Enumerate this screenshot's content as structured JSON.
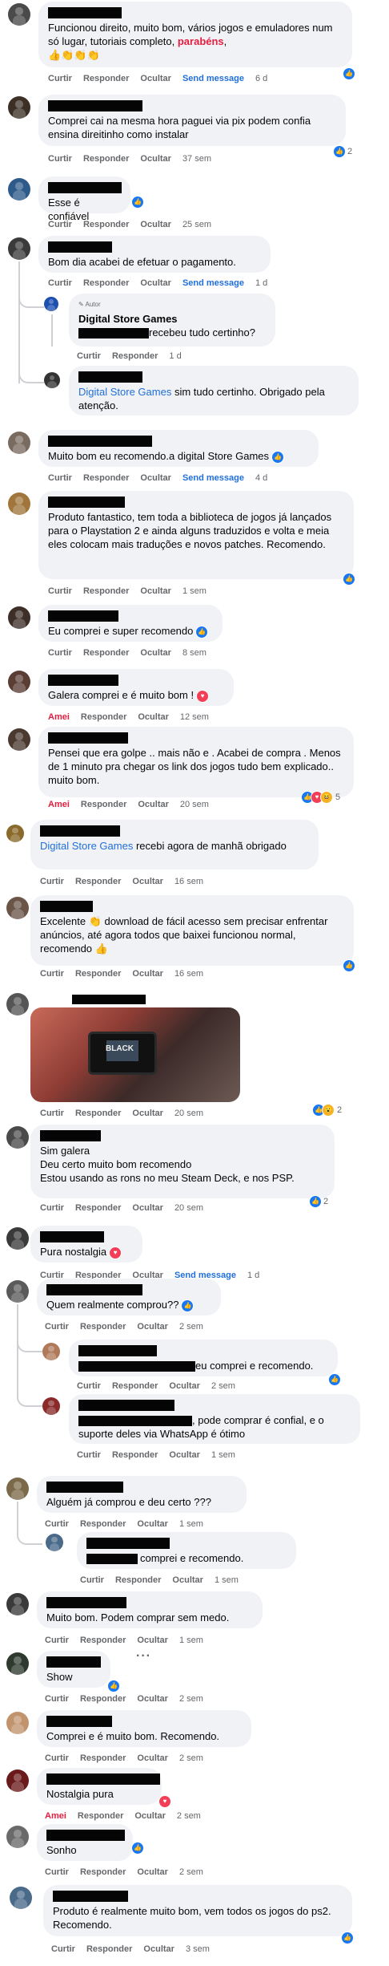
{
  "colors": {
    "link": "#216fdb",
    "love": "#e41e3f",
    "bubble": "#f0f2f5",
    "meta": "#65676b"
  },
  "labels": {
    "curtir": "Curtir",
    "responder": "Responder",
    "ocultar": "Ocultar",
    "send_message": "Send message",
    "amei": "Amei",
    "autor": "Autor"
  },
  "comments": [
    {
      "text": "Funcionou direito, muito bom, vários jogos e emuladores num só lugar, tutoriais completo, ",
      "highlight": "parabéns",
      "tail": ",",
      "emoji": "👍👏👏👏",
      "time": "6 d"
    },
    {
      "text": "Comprei cai na mesma hora paguei via pix podem confia ensina direitinho como instalar",
      "time": "37 sem",
      "react_count": "2"
    },
    {
      "text": "Esse é confiável",
      "time": "25 sem"
    },
    {
      "text": "Bom dia acabei de efetuar o pagamento.",
      "time": "1 d"
    },
    {
      "author": "Digital Store Games",
      "text": "recebeu tudo certinho?",
      "time": "1 d"
    },
    {
      "mention": "Digital Store Games",
      "text": " sim tudo certinho. Obrigado pela atenção."
    },
    {
      "text": "Muito bom eu recomendo.a digital Store Games",
      "time": "4 d"
    },
    {
      "text": "Produto fantastico, tem toda a biblioteca de jogos já lançados para o Playstation 2 e ainda alguns traduzidos e volta e meia eles colocam mais traduções e novos patches. Recomendo.",
      "time": "1 sem"
    },
    {
      "text": "Eu comprei e super recomendo",
      "time": "8 sem"
    },
    {
      "text": "Galera comprei e é muito bom !",
      "time": "12 sem"
    },
    {
      "text": "Pensei que era golpe .. mais não e . Acabei de compra . Menos de 1 minuto pra chegar os link dos jogos tudo bem explicado.. muito bom.",
      "time": "20 sem",
      "react_count": "5"
    },
    {
      "mention": "Digital Store Games",
      "text": " recebi agora de manhã obrigado",
      "time": "16 sem"
    },
    {
      "text": "Excelente 👏 download de fácil acesso sem precisar enfrentar anúncios, até agora todos que baixei funcionou normal, recomendo 👍",
      "time": "16 sem"
    },
    {
      "photo_text": "BLACK",
      "time": "20 sem",
      "react_count": "2"
    },
    {
      "text": "Sim galera\nDeu certo muito bom recomendo\nEstou usando as rons no meu Steam Deck, e nos PSP.",
      "time": "20 sem",
      "react_count": "2"
    },
    {
      "text": "Pura nostalgia",
      "time": "1 d"
    },
    {
      "text": "Quem realmente comprou??",
      "time": "2 sem"
    },
    {
      "text": "eu comprei e recomendo.",
      "time": "2 sem"
    },
    {
      "text": ", pode comprar é confial, e o suporte deles via WhatsApp é ótimo",
      "time": "1 sem"
    },
    {
      "text": "Alguém já comprou e deu certo ???",
      "time": "1 sem"
    },
    {
      "text": "comprei e recomendo.",
      "time": "1 sem"
    },
    {
      "text": "Muito bom. Podem comprar sem medo.",
      "time": "1 sem"
    },
    {
      "text": "Show",
      "time": "2 sem"
    },
    {
      "text": "Comprei e é muito bom. Recomendo.",
      "time": "2 sem"
    },
    {
      "text": "Nostalgia pura",
      "time": "2 sem"
    },
    {
      "text": "Sonho",
      "time": "2 sem"
    },
    {
      "text": "Produto é realmente muito bom, vem todos os jogos do ps2. Recomendo.",
      "time": "3 sem"
    }
  ]
}
